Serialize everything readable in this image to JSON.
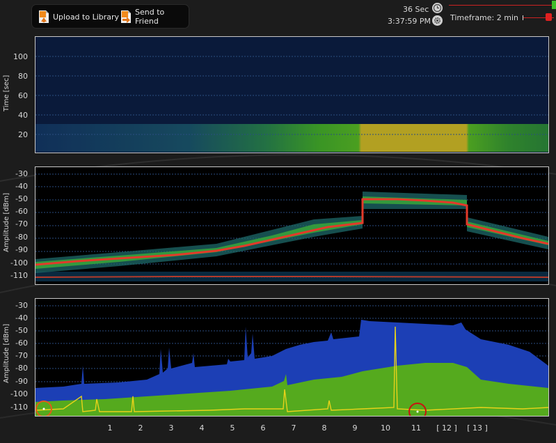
{
  "toolbar": {
    "upload_label": "Upload to Library",
    "send_label": "Send to Friend"
  },
  "status": {
    "elapsed": "36 Sec",
    "clock": "3:37:59 PM",
    "timeframe": "Timeframe: 2 min"
  },
  "waterfall": {
    "ylabel": "Time [sec]",
    "yticks": [
      "100",
      "80",
      "60",
      "40",
      "20"
    ]
  },
  "density": {
    "ylabel": "Amplitude [dBm]",
    "yticks": [
      "-30",
      "-40",
      "-50",
      "-60",
      "-70",
      "-80",
      "-90",
      "-100",
      "-110"
    ]
  },
  "spectrum": {
    "ylabel": "Amplitude [dBm]",
    "yticks": [
      "-30",
      "-40",
      "-50",
      "-60",
      "-70",
      "-80",
      "-90",
      "-100",
      "-110"
    ]
  },
  "xaxis": {
    "ticks": [
      "1",
      "2",
      "3",
      "4",
      "5",
      "6",
      "7",
      "8",
      "9",
      "10",
      "11",
      "[ 12 ]",
      "[ 13 ]"
    ]
  },
  "colors": {
    "max_hold": "#1c3fb5",
    "average": "#55aa1e",
    "current": "#e8d21a",
    "marker": "#cc1111"
  }
}
